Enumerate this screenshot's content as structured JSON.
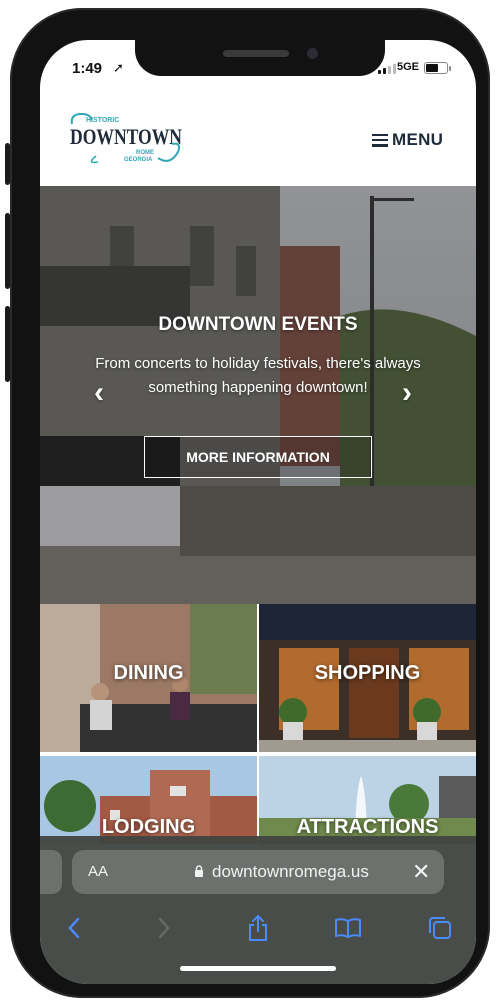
{
  "status_bar": {
    "time": "1:49",
    "network": "5GE"
  },
  "header": {
    "logo": {
      "historic": "HISTORIC",
      "downtown": "DOWNTOWN",
      "rome": "ROME",
      "georgia": "GEORGIA"
    },
    "menu_label": "MENU"
  },
  "hero": {
    "title": "DOWNTOWN EVENTS",
    "subtitle": "From concerts to holiday festivals, there's always something happening downtown!",
    "prev": "‹",
    "next": "›",
    "cta_label": "MORE INFORMATION"
  },
  "tiles": [
    {
      "label": "DINING"
    },
    {
      "label": "SHOPPING"
    },
    {
      "label": "LODGING"
    },
    {
      "label": "ATTRACTIONS"
    }
  ],
  "browser": {
    "aa_label": "AA",
    "url": "downtownromega.us",
    "close_symbol": "✕"
  },
  "colors": {
    "brand_navy": "#1f2a3a",
    "brand_teal": "#2ea7b3",
    "toolbar_blue": "#4a8cff"
  }
}
